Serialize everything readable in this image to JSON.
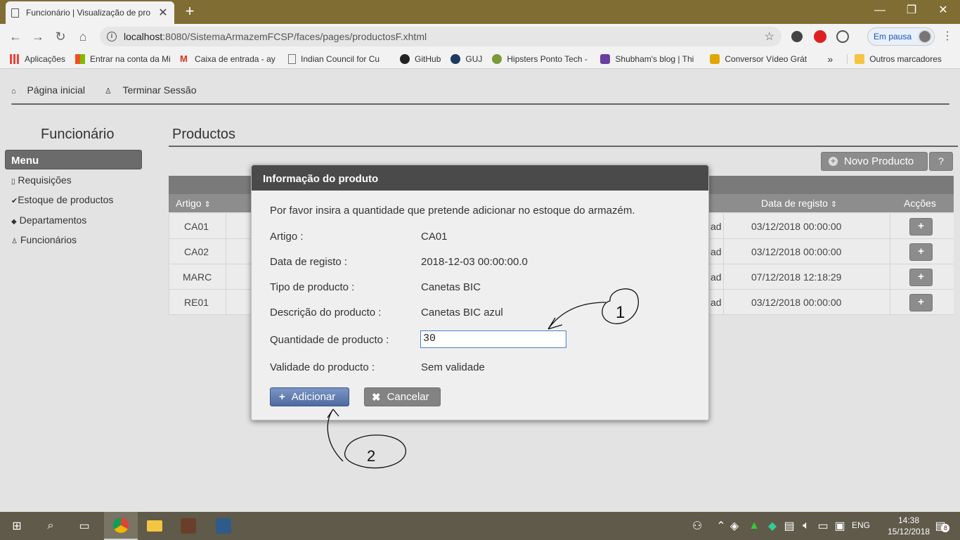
{
  "browser": {
    "tab_title": "Funcionário | Visualização de pro",
    "tab_close": "✕",
    "new_tab": "+",
    "url_host": "localhost",
    "url_path": ":8080/SistemaArmazemFCSP/faces/pages/productosF.xhtml",
    "profile_label": "Em pausa",
    "bookmarks": [
      {
        "label": "Aplicações",
        "icon": "apps-grid-icon",
        "color": "#e8453c"
      },
      {
        "label": "Entrar na conta da Mi",
        "icon": "microsoft-icon",
        "color": "#f25022"
      },
      {
        "label": "Caixa de entrada - ay",
        "icon": "gmail-icon",
        "color": "#d93025"
      },
      {
        "label": "Indian Council for Cu",
        "icon": "page-icon",
        "color": "#777777"
      },
      {
        "label": "GitHub",
        "icon": "github-icon",
        "color": "#222222"
      },
      {
        "label": "GUJ",
        "icon": "guj-icon",
        "color": "#1e3a5f"
      },
      {
        "label": "Hipsters Ponto Tech -",
        "icon": "hipsters-icon",
        "color": "#7a9a3a"
      },
      {
        "label": "Shubham's blog | Thi",
        "icon": "blog-icon",
        "color": "#6a3fa0"
      },
      {
        "label": "Conversor Vídeo Grát",
        "icon": "converter-icon",
        "color": "#e0a800"
      }
    ],
    "bookmarks_more": "»",
    "other_bookmarks": "Outros marcadores"
  },
  "app": {
    "top_nav": {
      "home": "Página inicial",
      "logout": "Terminar Sessão"
    },
    "sidebar": {
      "title": "Funcionário",
      "menu_header": "Menu",
      "items": [
        {
          "label": "Requisições",
          "icon": "document-icon"
        },
        {
          "label": "Estoque de productos",
          "icon": "check-icon"
        },
        {
          "label": "Departamentos",
          "icon": "tag-icon"
        },
        {
          "label": "Funcionários",
          "icon": "user-icon"
        }
      ]
    },
    "main": {
      "title": "Productos",
      "new_button": "Novo Producto",
      "help_button": "?",
      "columns": {
        "artigo": "Artigo",
        "data": "Data de registo",
        "accoes": "Acções"
      },
      "sort_glyph": "⇕",
      "rows": [
        {
          "artigo": "CA01",
          "frag": "ad",
          "data": "03/12/2018 00:00:00",
          "action": "+"
        },
        {
          "artigo": "CA02",
          "frag": "ad",
          "data": "03/12/2018 00:00:00",
          "action": "+"
        },
        {
          "artigo": "MARC",
          "frag": "ad",
          "data": "07/12/2018 12:18:29",
          "action": "+"
        },
        {
          "artigo": "RE01",
          "frag": "ad",
          "data": "03/12/2018 00:00:00",
          "action": "+"
        }
      ]
    }
  },
  "dialog": {
    "title": "Informação do produto",
    "message": "Por favor insira a quantidade que pretende adicionar no estoque do armazém.",
    "fields": [
      {
        "label": "Artigo :",
        "value": "CA01"
      },
      {
        "label": "Data de registo :",
        "value": "2018-12-03 00:00:00.0"
      },
      {
        "label": "Tipo de producto :",
        "value": "Canetas BIC"
      },
      {
        "label": "Descrição do producto :",
        "value": "Canetas BIC azul"
      }
    ],
    "quantity_label": "Quantidade de producto :",
    "quantity_value": "30",
    "validity_label": "Validade do producto :",
    "validity_value": "Sem validade",
    "add_button": "Adicionar",
    "add_glyph": "+",
    "cancel_button": "Cancelar",
    "cancel_glyph": "✖"
  },
  "annotations": {
    "mark_1": "1",
    "mark_2": "2"
  },
  "taskbar": {
    "language": "ENG",
    "time": "14:38",
    "date": "15/12/2018",
    "notifications": "8"
  }
}
